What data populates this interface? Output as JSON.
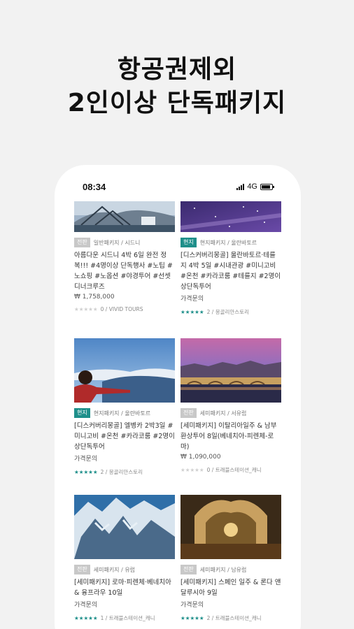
{
  "headline": {
    "line1": "항공권제외",
    "line2": "2인이상 단독패키지"
  },
  "status_bar": {
    "time": "08:34",
    "network": "4G"
  },
  "products": [
    {
      "badge": "전판",
      "category": "일반패키지 / 시드니",
      "title": "아름다운 시드니 4박 6일 완전 정복!!! #4명이상 단독행사 #노팁 #노쇼핑 #노옵션 #야경투어 #선셋디너크루즈",
      "price": "₩ 1,758,000",
      "stars": "★★★★★",
      "review": "0 / VIVID TOURS"
    },
    {
      "badge": "현지",
      "category": "현지패키지 / 울란바토르",
      "title": "[디스커버리몽골] 울란바토르·테를지 4박 5일 #시내관광 #미니고비 #온천 #카라코룸 #테를지 #2명이상단독투어",
      "price": "가격문의",
      "stars": "★★★★★",
      "review": "2 / 몽골리안스토리"
    },
    {
      "badge": "현지",
      "category": "현지패키지 / 울란바토르",
      "title": "[디스커버리몽골] 엘벵카 2박3일 #미니고비 #온천 #카라코룸 #2명이상단독투어",
      "price": "가격문의",
      "stars": "★★★★★",
      "review": "2 / 몽골리안스토리"
    },
    {
      "badge": "전판",
      "category": "세미패키지 / 서유럽",
      "title": "[세미패키지] 이탈리아일주 & 남부환상투어 8일(베네치아-피렌체-로마)",
      "price": "₩ 1,090,000",
      "stars": "★★★★★",
      "review": "0 / 트래블스테이션_캐니"
    },
    {
      "badge": "전판",
      "category": "세미패키지 / 유럽",
      "title": "[세미패키지] 로마·피렌체·베네치아 & 융프라우 10일",
      "price": "가격문의",
      "stars": "★★★★★",
      "review": "1 / 트래블스테이션_캐니"
    },
    {
      "badge": "전판",
      "category": "세미패키지 / 남유럽",
      "title": "[세미패키지] 스페인 일주 & 론다 앤달루시아 9일",
      "price": "가격문의",
      "stars": "★★★★★",
      "review": "2 / 트래블스테이션_캐니"
    }
  ]
}
